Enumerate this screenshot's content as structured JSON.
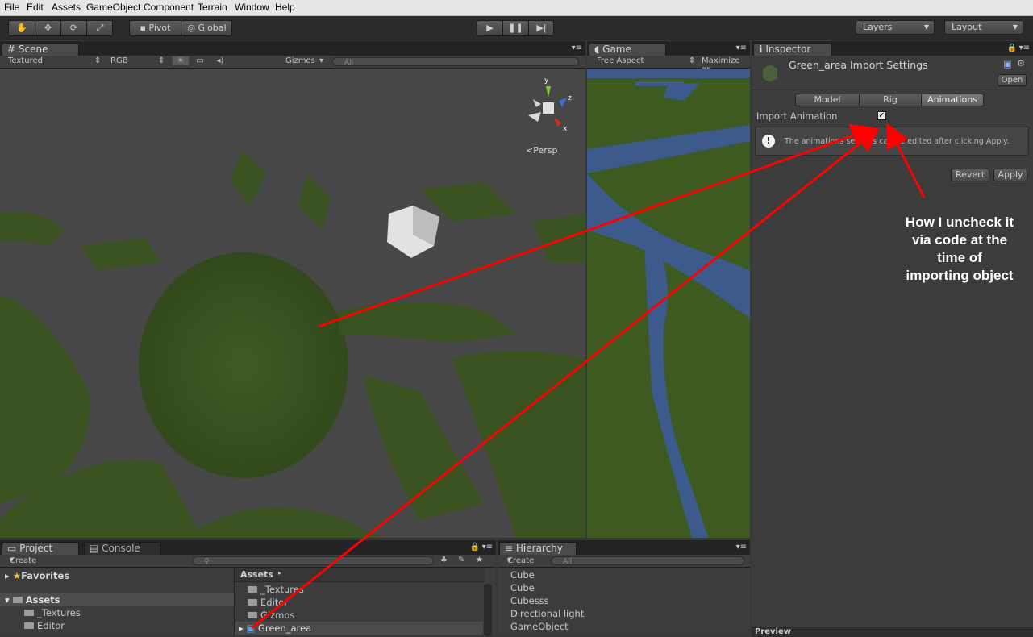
{
  "menubar": [
    "File",
    "Edit",
    "Assets",
    "GameObject",
    "Component",
    "Terrain",
    "Window",
    "Help"
  ],
  "toolbar": {
    "pivot": "Pivot",
    "global": "Global",
    "layers": "Layers",
    "layout": "Layout"
  },
  "scene": {
    "tab": "Scene",
    "shading": "Textured",
    "render_mode": "RGB",
    "gizmos": "Gizmos",
    "search_placeholder": "All",
    "persp": "Persp",
    "axis_labels": {
      "y": "y",
      "z": "z",
      "x": "x"
    }
  },
  "game": {
    "tab": "Game",
    "aspect": "Free Aspect",
    "maximize": "Maximize or"
  },
  "inspector": {
    "tab": "Inspector",
    "title": "Green_area Import Settings",
    "open": "Open",
    "tabs": [
      "Model",
      "Rig",
      "Animations"
    ],
    "active_tab": "Animations",
    "import_label": "Import Animation",
    "import_checked": true,
    "info_text": "The animations settings can be edited after clicking Apply.",
    "revert": "Revert",
    "apply": "Apply",
    "preview": "Preview"
  },
  "annotation": {
    "text": "How I uncheck it via code at the time of importing object",
    "lines": [
      "How I uncheck it",
      "via code at the",
      "time of",
      "importing object"
    ],
    "color": "#ff0000"
  },
  "project": {
    "tab": "Project",
    "console_tab": "Console",
    "create": "Create",
    "favorites": "Favorites",
    "assets_root": "Assets",
    "tree": [
      "_Textures",
      "Editor"
    ],
    "breadcrumb": "Assets",
    "files": [
      "_Textures",
      "Editor",
      "Gizmos",
      "Green_area"
    ]
  },
  "hierarchy": {
    "tab": "Hierarchy",
    "create": "Create",
    "search_placeholder": "All",
    "items": [
      "Cube",
      "Cube",
      "Cubesss",
      "Directional light",
      "GameObject"
    ]
  }
}
